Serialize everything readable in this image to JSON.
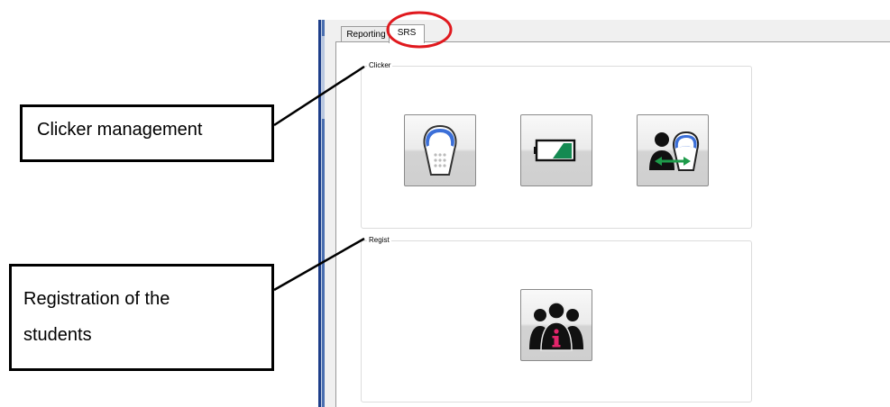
{
  "tabs": [
    {
      "label": "Reporting"
    },
    {
      "label": "SRS"
    }
  ],
  "groups": {
    "clicker": {
      "label": "Clicker"
    },
    "regist": {
      "label": "Regist"
    }
  },
  "buttons": {
    "clicker": {
      "icon": "clicker-remote-icon"
    },
    "battery": {
      "icon": "battery-icon"
    },
    "assign": {
      "icon": "assign-clicker-icon"
    },
    "students": {
      "icon": "student-registration-icon"
    }
  },
  "annotations": {
    "clicker_management": "Clicker management",
    "registration_line1": "Registration of the",
    "registration_line2": "students"
  },
  "colors": {
    "highlight": "#e0191e",
    "remote_blue": "#3b6fd8",
    "battery_green": "#148a52",
    "arrow_green": "#1e9b4a",
    "info_pink": "#e3256b"
  }
}
